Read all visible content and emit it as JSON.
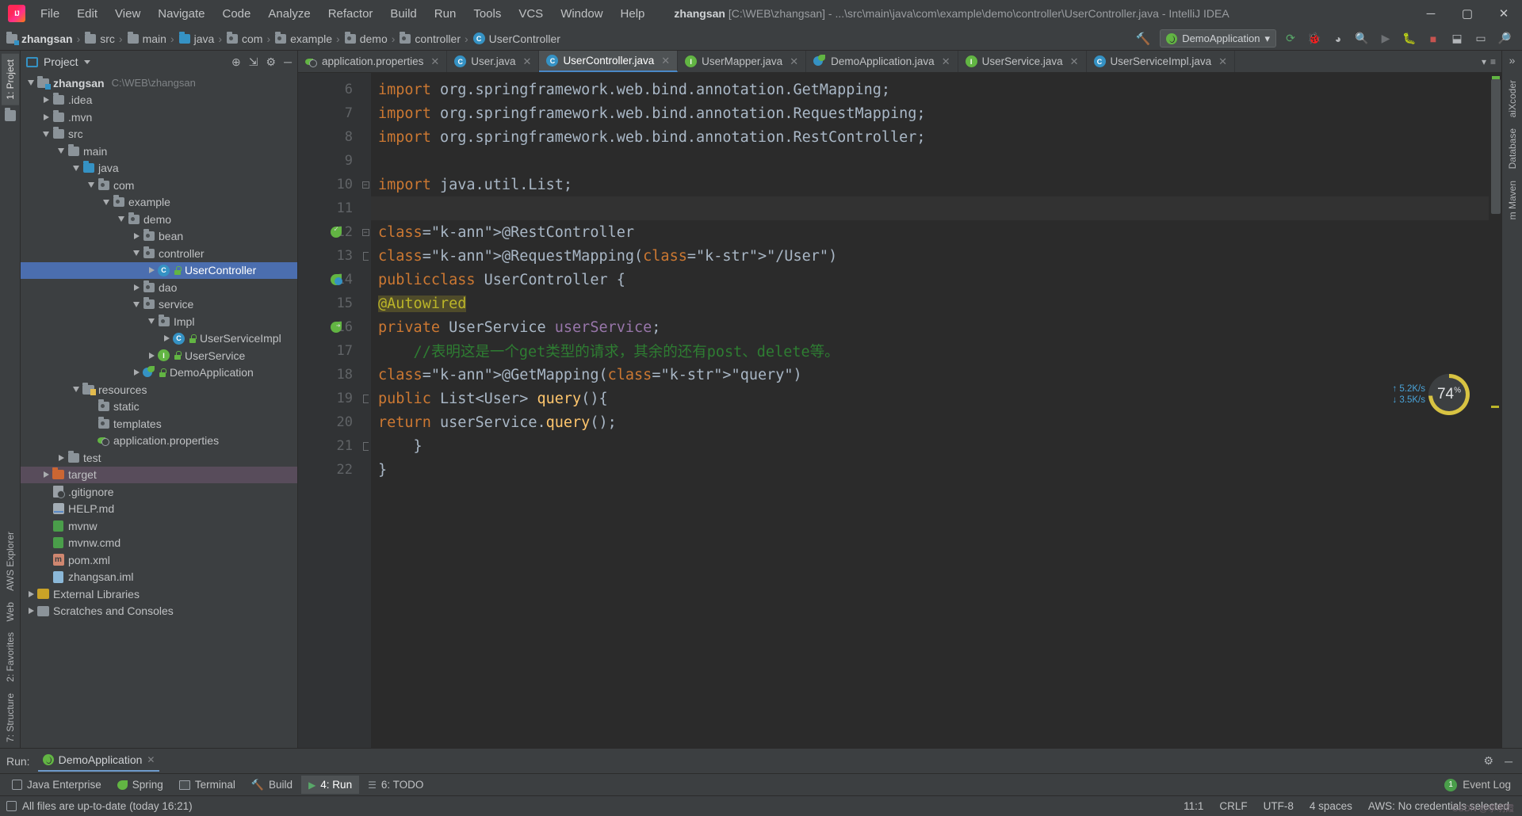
{
  "titlebar": {
    "logo_name": "intellij-logo",
    "menus": [
      "File",
      "Edit",
      "View",
      "Navigate",
      "Code",
      "Analyze",
      "Refactor",
      "Build",
      "Run",
      "Tools",
      "VCS",
      "Window",
      "Help"
    ],
    "project_name": "zhangsan",
    "title_rest": "[C:\\WEB\\zhangsan] - ...\\src\\main\\java\\com\\example\\demo\\controller\\UserController.java - IntelliJ IDEA",
    "minimize": "─",
    "maximize": "▢",
    "close": "✕"
  },
  "navbar": {
    "crumbs": [
      {
        "label": "zhangsan",
        "icon": "module-folder-icon"
      },
      {
        "label": "src",
        "icon": "folder-icon"
      },
      {
        "label": "main",
        "icon": "folder-icon"
      },
      {
        "label": "java",
        "icon": "source-folder-icon"
      },
      {
        "label": "com",
        "icon": "package-icon"
      },
      {
        "label": "example",
        "icon": "package-icon"
      },
      {
        "label": "demo",
        "icon": "package-icon"
      },
      {
        "label": "controller",
        "icon": "package-icon"
      },
      {
        "label": "UserController",
        "icon": "class-icon"
      }
    ],
    "separator": "›",
    "run_config": "DemoApplication",
    "caret": "▾"
  },
  "left_strip": {
    "tabs": [
      {
        "label": "1: Project",
        "active": true
      },
      {
        "label": "AWS Explorer",
        "active": false
      },
      {
        "label": "Web",
        "active": false
      },
      {
        "label": "2: Favorites",
        "active": false
      },
      {
        "label": "7: Structure",
        "active": false
      }
    ]
  },
  "right_strip": {
    "tabs": [
      {
        "label": "aiXcoder"
      },
      {
        "label": "Database"
      },
      {
        "label": "m Maven"
      }
    ]
  },
  "project_panel": {
    "title": "Project",
    "root_label": "zhangsan",
    "root_path": "C:\\WEB\\zhangsan",
    "tree": [
      {
        "label": ".idea",
        "depth": 1,
        "arrow": "right",
        "icon": "folder-icon"
      },
      {
        "label": ".mvn",
        "depth": 1,
        "arrow": "right",
        "icon": "folder-icon"
      },
      {
        "label": "src",
        "depth": 1,
        "arrow": "down",
        "icon": "folder-icon"
      },
      {
        "label": "main",
        "depth": 2,
        "arrow": "down",
        "icon": "folder-icon"
      },
      {
        "label": "java",
        "depth": 3,
        "arrow": "down",
        "icon": "source-folder-icon"
      },
      {
        "label": "com",
        "depth": 4,
        "arrow": "down",
        "icon": "package-icon"
      },
      {
        "label": "example",
        "depth": 5,
        "arrow": "down",
        "icon": "package-icon"
      },
      {
        "label": "demo",
        "depth": 6,
        "arrow": "down",
        "icon": "package-icon"
      },
      {
        "label": "bean",
        "depth": 7,
        "arrow": "right",
        "icon": "package-icon"
      },
      {
        "label": "controller",
        "depth": 7,
        "arrow": "down",
        "icon": "package-icon"
      },
      {
        "label": "UserController",
        "depth": 8,
        "arrow": "right",
        "icon": "class-icon",
        "selected": true,
        "lock": true
      },
      {
        "label": "dao",
        "depth": 7,
        "arrow": "right",
        "icon": "package-icon"
      },
      {
        "label": "service",
        "depth": 7,
        "arrow": "down",
        "icon": "package-icon"
      },
      {
        "label": "Impl",
        "depth": 8,
        "arrow": "down",
        "icon": "package-icon"
      },
      {
        "label": "UserServiceImpl",
        "depth": 9,
        "arrow": "right",
        "icon": "class-icon",
        "lock": true
      },
      {
        "label": "UserService",
        "depth": 8,
        "arrow": "right",
        "icon": "interface-icon",
        "lock": true
      },
      {
        "label": "DemoApplication",
        "depth": 7,
        "arrow": "right",
        "icon": "spring-class-icon",
        "lock": true
      },
      {
        "label": "resources",
        "depth": 3,
        "arrow": "down",
        "icon": "resources-folder-icon"
      },
      {
        "label": "static",
        "depth": 4,
        "arrow": "none",
        "icon": "package-icon"
      },
      {
        "label": "templates",
        "depth": 4,
        "arrow": "none",
        "icon": "package-icon"
      },
      {
        "label": "application.properties",
        "depth": 4,
        "arrow": "none",
        "icon": "spring-properties-icon"
      },
      {
        "label": "test",
        "depth": 2,
        "arrow": "right",
        "icon": "folder-icon"
      },
      {
        "label": "target",
        "depth": 1,
        "arrow": "right",
        "icon": "excluded-folder-icon",
        "excluded": true
      },
      {
        "label": ".gitignore",
        "depth": 1,
        "arrow": "none",
        "icon": "gitignore-icon"
      },
      {
        "label": "HELP.md",
        "depth": 1,
        "arrow": "none",
        "icon": "markdown-icon"
      },
      {
        "label": "mvnw",
        "depth": 1,
        "arrow": "none",
        "icon": "shell-script-icon"
      },
      {
        "label": "mvnw.cmd",
        "depth": 1,
        "arrow": "none",
        "icon": "shell-script-icon"
      },
      {
        "label": "pom.xml",
        "depth": 1,
        "arrow": "none",
        "icon": "maven-xml-icon"
      },
      {
        "label": "zhangsan.iml",
        "depth": 1,
        "arrow": "none",
        "icon": "iml-icon"
      },
      {
        "label": "External Libraries",
        "depth": 0,
        "arrow": "right",
        "icon": "library-icon"
      },
      {
        "label": "Scratches and Consoles",
        "depth": 0,
        "arrow": "right",
        "icon": "scratches-icon"
      }
    ]
  },
  "editor": {
    "tabs": [
      {
        "label": "application.properties",
        "icon": "spring-properties-icon",
        "active": false
      },
      {
        "label": "User.java",
        "icon": "class-icon",
        "active": false
      },
      {
        "label": "UserController.java",
        "icon": "class-icon",
        "active": true
      },
      {
        "label": "UserMapper.java",
        "icon": "interface-icon",
        "active": false
      },
      {
        "label": "DemoApplication.java",
        "icon": "spring-class-icon",
        "active": false
      },
      {
        "label": "UserService.java",
        "icon": "interface-icon",
        "active": false
      },
      {
        "label": "UserServiceImpl.java",
        "icon": "class-icon",
        "active": false
      }
    ],
    "close_glyph": "✕",
    "overflow_glyph": "≡",
    "lines": [
      {
        "num": "6",
        "text": "import org.springframework.web.bind.annotation.GetMapping;"
      },
      {
        "num": "7",
        "text": "import org.springframework.web.bind.annotation.RequestMapping;"
      },
      {
        "num": "8",
        "text": "import org.springframework.web.bind.annotation.RestController;"
      },
      {
        "num": "9",
        "text": ""
      },
      {
        "num": "10",
        "text": "import java.util.List;"
      },
      {
        "num": "11",
        "text": ""
      },
      {
        "num": "12",
        "text": "@RestController"
      },
      {
        "num": "13",
        "text": "@RequestMapping(\"/User\")"
      },
      {
        "num": "14",
        "text": "public class UserController {"
      },
      {
        "num": "15",
        "text": "    @Autowired"
      },
      {
        "num": "16",
        "text": "    private UserService userService;"
      },
      {
        "num": "17",
        "text": "    //表明这是一个get类型的请求，其余的还有post、delete等。"
      },
      {
        "num": "18",
        "text": "    @GetMapping(\"query\")"
      },
      {
        "num": "19",
        "text": "    public List<User> query(){"
      },
      {
        "num": "20",
        "text": "        return userService.query();"
      },
      {
        "num": "21",
        "text": "    }"
      },
      {
        "num": "22",
        "text": "}"
      }
    ]
  },
  "widgets": {
    "upload_rate": "5.2K/s",
    "download_rate": "3.5K/s",
    "cpu_percent": "74",
    "cpu_suffix": "%"
  },
  "run_panel": {
    "label": "Run:",
    "tab_label": "DemoApplication",
    "close_glyph": "✕",
    "settings_glyph": "⚙",
    "minimize_glyph": "─"
  },
  "bottom_bar": {
    "tabs": [
      {
        "label": "Java Enterprise",
        "icon": "java-enterprise-icon",
        "active": false
      },
      {
        "label": "Spring",
        "icon": "spring-leaf-icon",
        "active": false
      },
      {
        "label": "Terminal",
        "icon": "terminal-icon",
        "active": false
      },
      {
        "label": "Build",
        "icon": "build-hammer-icon",
        "active": false
      },
      {
        "label": "4: Run",
        "icon": "run-play-icon",
        "active": true
      },
      {
        "label": "6: TODO",
        "icon": "todo-icon",
        "active": false
      }
    ],
    "event_log": "Event Log",
    "event_count": "1"
  },
  "status_bar": {
    "message": "All files are up-to-date (today 16:21)",
    "caret_position": "11:1",
    "line_separator": "CRLF",
    "encoding": "UTF-8",
    "indent": "4 spaces",
    "aws": "AWS: No credentials selected",
    "watermark": "CSDN @李明霞"
  },
  "colors": {
    "accent_blue": "#4b6eaf",
    "keyword_orange": "#cc7832",
    "string_green": "#6a8759",
    "annotation_yellow": "#bbb529",
    "comment_green": "#2e7d32",
    "field_purple": "#9876aa",
    "bg_editor": "#2b2b2b",
    "bg_chrome": "#3c3f41"
  }
}
